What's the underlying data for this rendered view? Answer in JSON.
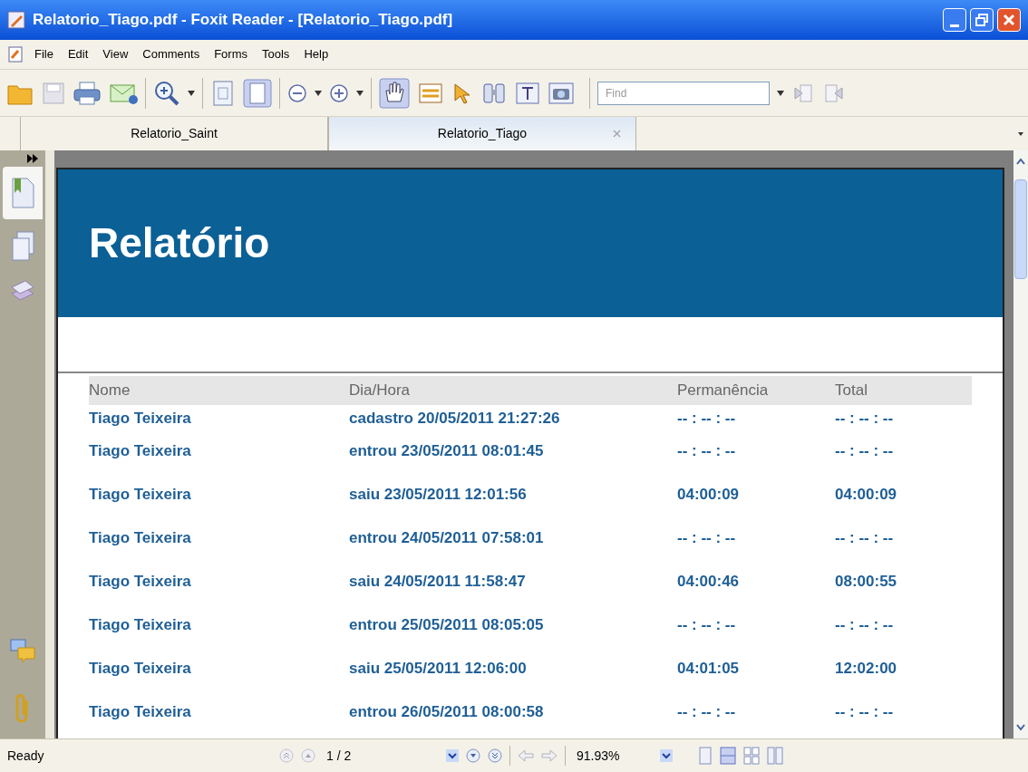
{
  "window": {
    "title": "Relatorio_Tiago.pdf - Foxit Reader - [Relatorio_Tiago.pdf]"
  },
  "menu": [
    "File",
    "Edit",
    "View",
    "Comments",
    "Forms",
    "Tools",
    "Help"
  ],
  "find": {
    "placeholder": "Find"
  },
  "tabs": [
    {
      "label": "Relatorio_Saint",
      "selected": false
    },
    {
      "label": "Relatorio_Tiago",
      "selected": true
    }
  ],
  "document": {
    "heading": "Relatório",
    "columns": [
      "Nome",
      "Dia/Hora",
      "Permanência",
      "Total"
    ],
    "rows": [
      [
        "Tiago Teixeira",
        "cadastro 20/05/2011 21:27:26",
        "-- : -- : --",
        "-- : -- : --"
      ],
      [
        "Tiago Teixeira",
        "entrou 23/05/2011 08:01:45",
        "-- : -- : --",
        "-- : -- : --"
      ],
      [
        "Tiago Teixeira",
        "saiu 23/05/2011 12:01:56",
        "04:00:09",
        "04:00:09"
      ],
      [
        "Tiago Teixeira",
        "entrou 24/05/2011 07:58:01",
        "-- : -- : --",
        "-- : -- : --"
      ],
      [
        "Tiago Teixeira",
        "saiu 24/05/2011 11:58:47",
        "04:00:46",
        "08:00:55"
      ],
      [
        "Tiago Teixeira",
        "entrou 25/05/2011 08:05:05",
        "-- : -- : --",
        "-- : -- : --"
      ],
      [
        "Tiago Teixeira",
        "saiu 25/05/2011 12:06:00",
        "04:01:05",
        "12:02:00"
      ],
      [
        "Tiago Teixeira",
        "entrou 26/05/2011 08:00:58",
        "-- : -- : --",
        "-- : -- : --"
      ]
    ]
  },
  "status_bar": {
    "text": "Ready",
    "page": "1 / 2",
    "zoom": "91.93%"
  }
}
